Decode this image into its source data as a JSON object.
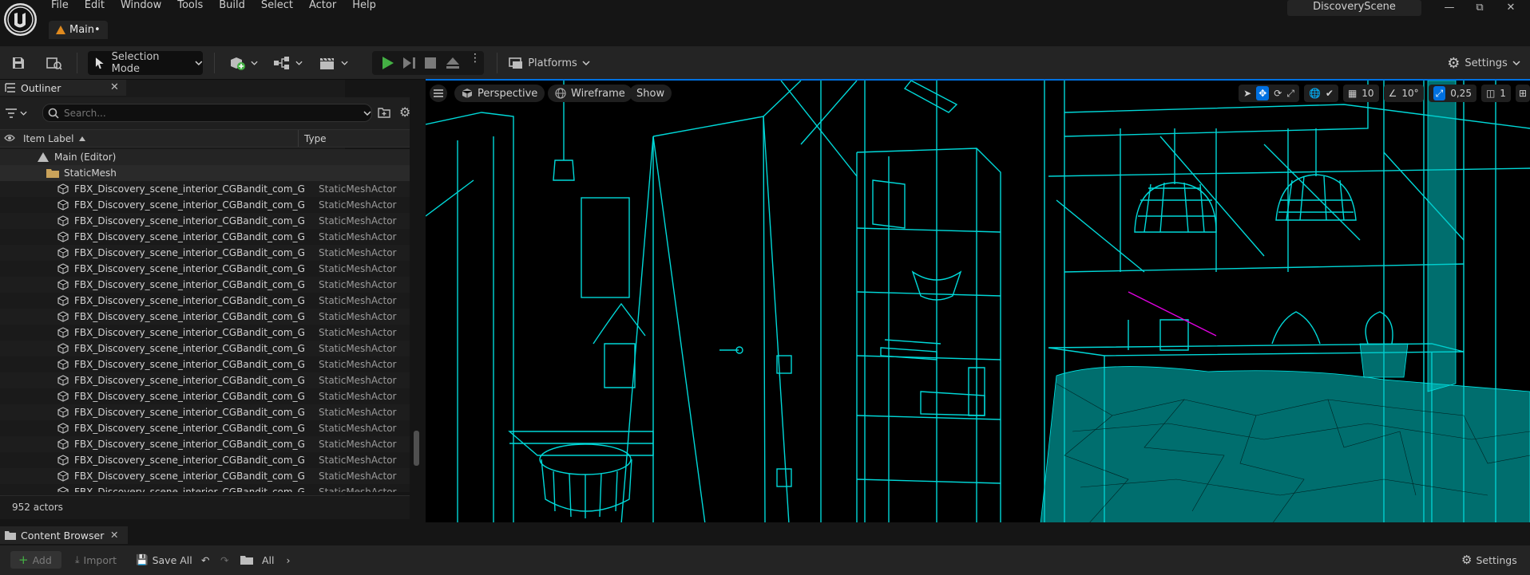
{
  "menu": [
    "File",
    "Edit",
    "Window",
    "Tools",
    "Build",
    "Select",
    "Actor",
    "Help"
  ],
  "tab": {
    "label": "Main•"
  },
  "project_name": "DiscoveryScene",
  "toolbar": {
    "selection_mode": "Selection Mode",
    "platforms": "Platforms",
    "settings": "Settings"
  },
  "outliner": {
    "title": "Outliner",
    "search_placeholder": "Search...",
    "col_label": "Item Label",
    "col_type": "Type",
    "root": "Main (Editor)",
    "folder": "StaticMesh",
    "rows": [
      {
        "label": "FBX_Discovery_scene_interior_CGBandit_com_G",
        "type": "StaticMeshActor"
      },
      {
        "label": "FBX_Discovery_scene_interior_CGBandit_com_G",
        "type": "StaticMeshActor"
      },
      {
        "label": "FBX_Discovery_scene_interior_CGBandit_com_G",
        "type": "StaticMeshActor"
      },
      {
        "label": "FBX_Discovery_scene_interior_CGBandit_com_G",
        "type": "StaticMeshActor"
      },
      {
        "label": "FBX_Discovery_scene_interior_CGBandit_com_G",
        "type": "StaticMeshActor"
      },
      {
        "label": "FBX_Discovery_scene_interior_CGBandit_com_G",
        "type": "StaticMeshActor"
      },
      {
        "label": "FBX_Discovery_scene_interior_CGBandit_com_G",
        "type": "StaticMeshActor"
      },
      {
        "label": "FBX_Discovery_scene_interior_CGBandit_com_G",
        "type": "StaticMeshActor"
      },
      {
        "label": "FBX_Discovery_scene_interior_CGBandit_com_G",
        "type": "StaticMeshActor"
      },
      {
        "label": "FBX_Discovery_scene_interior_CGBandit_com_G",
        "type": "StaticMeshActor"
      },
      {
        "label": "FBX_Discovery_scene_interior_CGBandit_com_G",
        "type": "StaticMeshActor"
      },
      {
        "label": "FBX_Discovery_scene_interior_CGBandit_com_G",
        "type": "StaticMeshActor"
      },
      {
        "label": "FBX_Discovery_scene_interior_CGBandit_com_G",
        "type": "StaticMeshActor"
      },
      {
        "label": "FBX_Discovery_scene_interior_CGBandit_com_G",
        "type": "StaticMeshActor"
      },
      {
        "label": "FBX_Discovery_scene_interior_CGBandit_com_G",
        "type": "StaticMeshActor"
      },
      {
        "label": "FBX_Discovery_scene_interior_CGBandit_com_G",
        "type": "StaticMeshActor"
      },
      {
        "label": "FBX_Discovery_scene_interior_CGBandit_com_G",
        "type": "StaticMeshActor"
      },
      {
        "label": "FBX_Discovery_scene_interior_CGBandit_com_G",
        "type": "StaticMeshActor"
      },
      {
        "label": "FBX_Discovery_scene_interior_CGBandit_com_G",
        "type": "StaticMeshActor"
      },
      {
        "label": "FBX_Discovery_scene_interior_CGBandit_com_G",
        "type": "StaticMeshActor"
      }
    ],
    "actor_count": "952 actors"
  },
  "viewport": {
    "perspective": "Perspective",
    "view_mode": "Wireframe",
    "show": "Show",
    "grid_snap": "10",
    "rotation_snap": "10°",
    "scale_snap": "0,25",
    "camera_speed": "1",
    "wire_color": "#00d8d8"
  },
  "content_browser": {
    "title": "Content Browser",
    "add": "Add",
    "import": "Import",
    "save_all": "Save All",
    "path": "All",
    "settings": "Settings"
  },
  "colors": {
    "accent": "#0070e0",
    "play": "#44b044",
    "wire": "#00d8d8"
  }
}
